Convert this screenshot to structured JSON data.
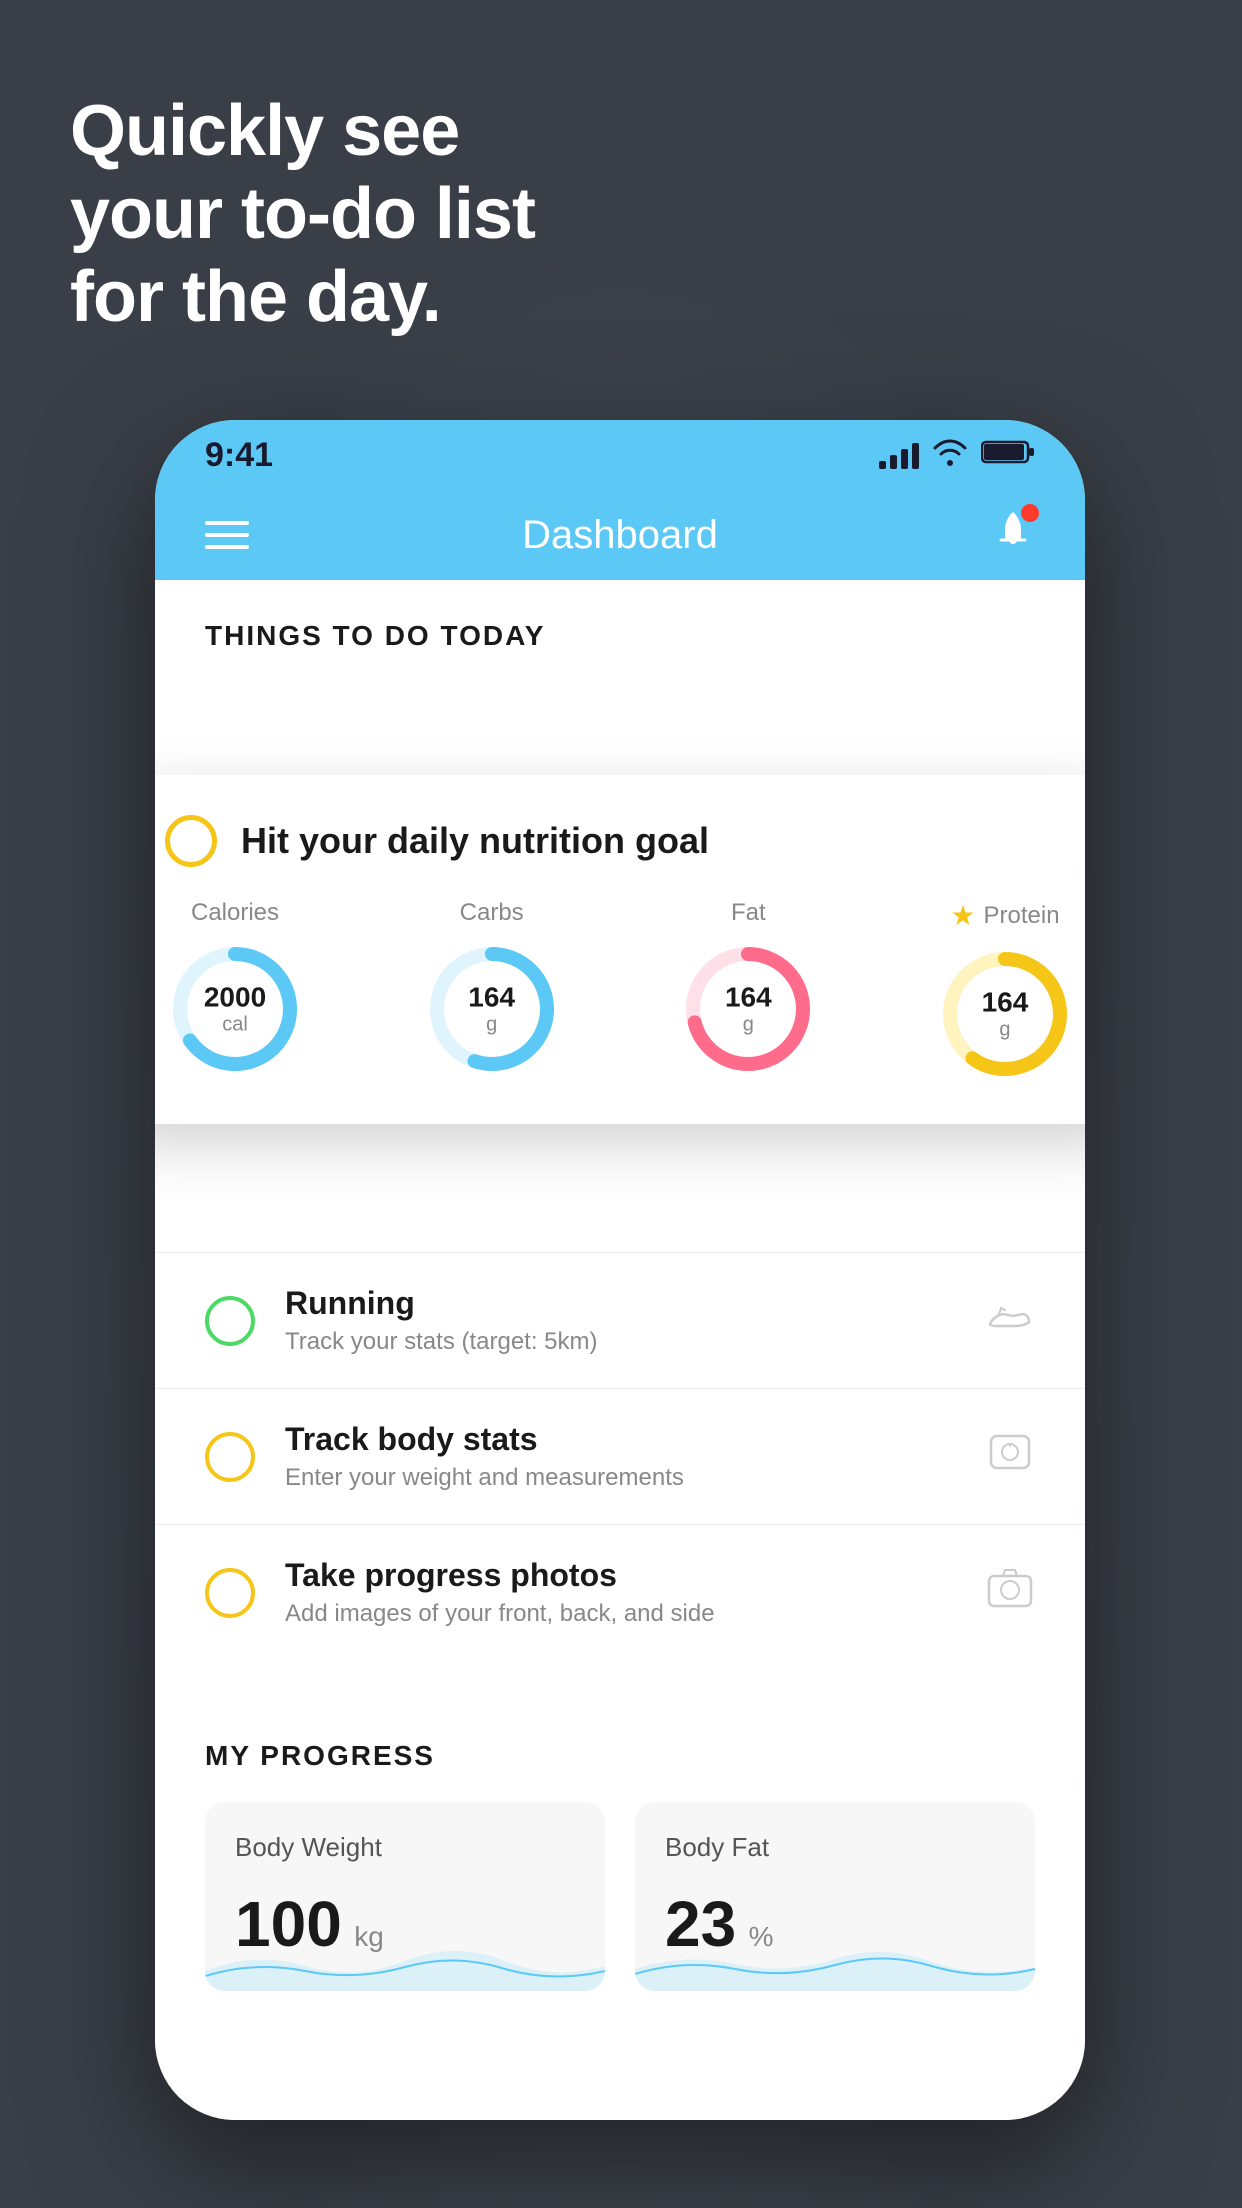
{
  "hero": {
    "line1": "Quickly see",
    "line2": "your to-do list",
    "line3": "for the day."
  },
  "status_bar": {
    "time": "9:41",
    "signal_bars": [
      8,
      14,
      20,
      26
    ],
    "wifi": "wifi",
    "battery": "battery"
  },
  "header": {
    "title": "Dashboard"
  },
  "things_section": {
    "label": "THINGS TO DO TODAY"
  },
  "nutrition_card": {
    "title": "Hit your daily nutrition goal",
    "items": [
      {
        "label": "Calories",
        "value": "2000",
        "unit": "cal",
        "color": "#5bc8f5",
        "track_color": "#e0f4fd",
        "percent": 65
      },
      {
        "label": "Carbs",
        "value": "164",
        "unit": "g",
        "color": "#5bc8f5",
        "track_color": "#e0f4fd",
        "percent": 55
      },
      {
        "label": "Fat",
        "value": "164",
        "unit": "g",
        "color": "#ff6b8a",
        "track_color": "#ffe0e8",
        "percent": 70
      },
      {
        "label": "Protein",
        "value": "164",
        "unit": "g",
        "color": "#f5c518",
        "track_color": "#fff3c0",
        "percent": 60,
        "starred": true
      }
    ]
  },
  "todo_items": [
    {
      "type": "green",
      "title": "Running",
      "subtitle": "Track your stats (target: 5km)",
      "icon": "shoe"
    },
    {
      "type": "yellow",
      "title": "Track body stats",
      "subtitle": "Enter your weight and measurements",
      "icon": "scale"
    },
    {
      "type": "yellow",
      "title": "Take progress photos",
      "subtitle": "Add images of your front, back, and side",
      "icon": "photo"
    }
  ],
  "progress_section": {
    "label": "MY PROGRESS",
    "cards": [
      {
        "title": "Body Weight",
        "value": "100",
        "unit": "kg"
      },
      {
        "title": "Body Fat",
        "value": "23",
        "unit": "%"
      }
    ]
  }
}
